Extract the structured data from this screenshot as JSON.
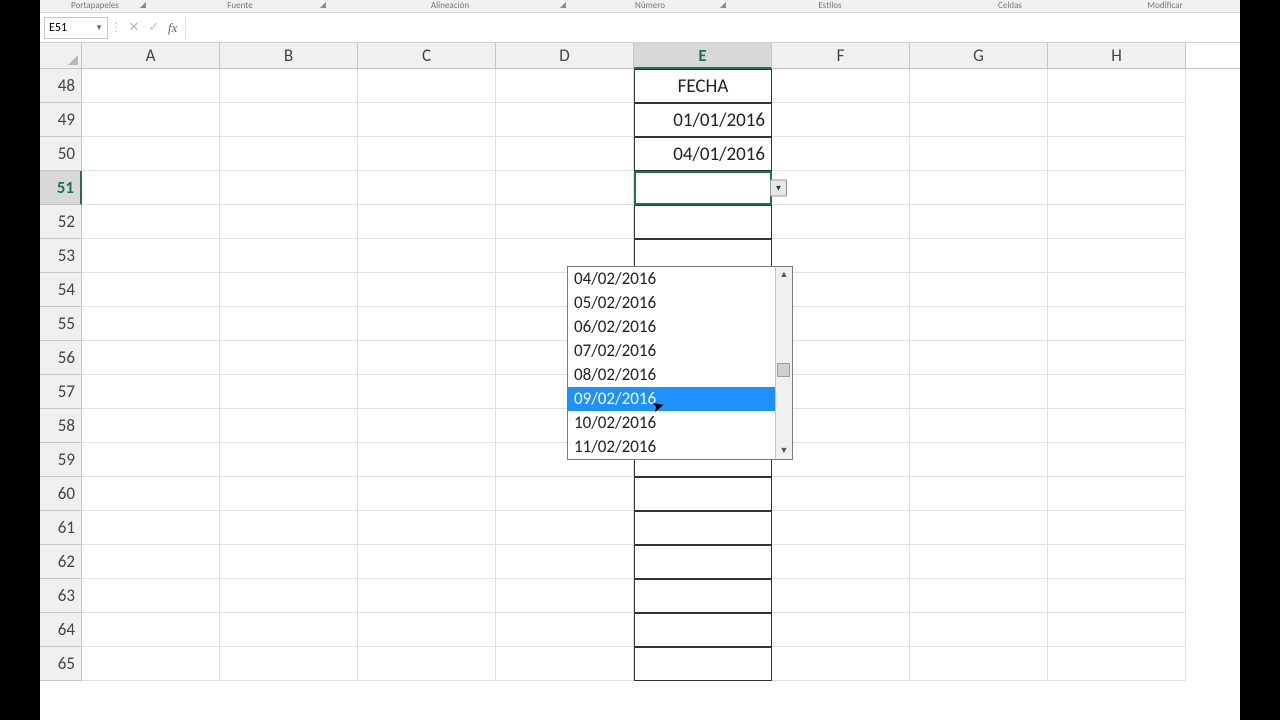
{
  "ribbon": {
    "groups": [
      "Portapapeles",
      "Fuente",
      "Alineación",
      "Número",
      "Estilos",
      "Celdas",
      "Modificar"
    ]
  },
  "namebox": {
    "value": "E51"
  },
  "formula": {
    "value": ""
  },
  "columns": [
    "A",
    "B",
    "C",
    "D",
    "E",
    "F",
    "G",
    "H"
  ],
  "rows": [
    48,
    49,
    50,
    51,
    52,
    53,
    54,
    55,
    56,
    57,
    58,
    59,
    60,
    61,
    62,
    63,
    64,
    65
  ],
  "active": {
    "col": "E",
    "row": 51
  },
  "data": {
    "E48": "FECHA",
    "E49": "01/01/2016",
    "E50": "04/01/2016"
  },
  "dropdown": {
    "items": [
      "04/02/2016",
      "05/02/2016",
      "06/02/2016",
      "07/02/2016",
      "08/02/2016",
      "09/02/2016",
      "10/02/2016",
      "11/02/2016"
    ],
    "selected": "09/02/2016"
  }
}
